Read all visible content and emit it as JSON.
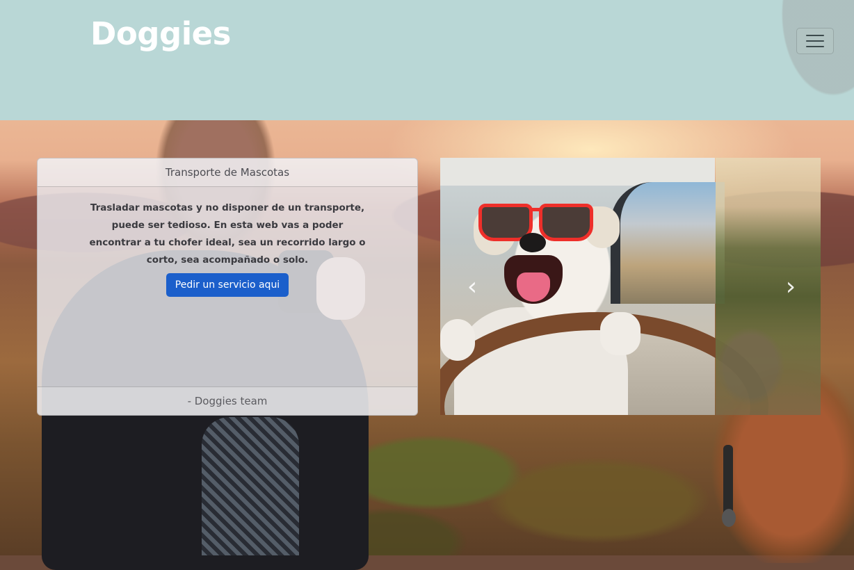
{
  "brand": "Doggies",
  "navbar": {
    "toggle_icon": "hamburger-menu-icon"
  },
  "card": {
    "header": "Transporte de Mascotas",
    "text": "Trasladar mascotas y no disponer de un transporte, puede ser tedioso. En esta web vas a poder encontrar a tu chofer ideal, sea un recorrido largo o corto, sea acompañado o solo.",
    "button_label": "Pedir un servicio aqui",
    "footer": "- Doggies team"
  },
  "carousel": {
    "prev_icon": "chevron-left-icon",
    "next_icon": "chevron-right-icon",
    "prev_glyph": "‹",
    "next_glyph": "›"
  },
  "colors": {
    "header_bg": "#b9d7d6",
    "button_bg": "#1b5fcb",
    "brand_text": "#ffffff"
  }
}
